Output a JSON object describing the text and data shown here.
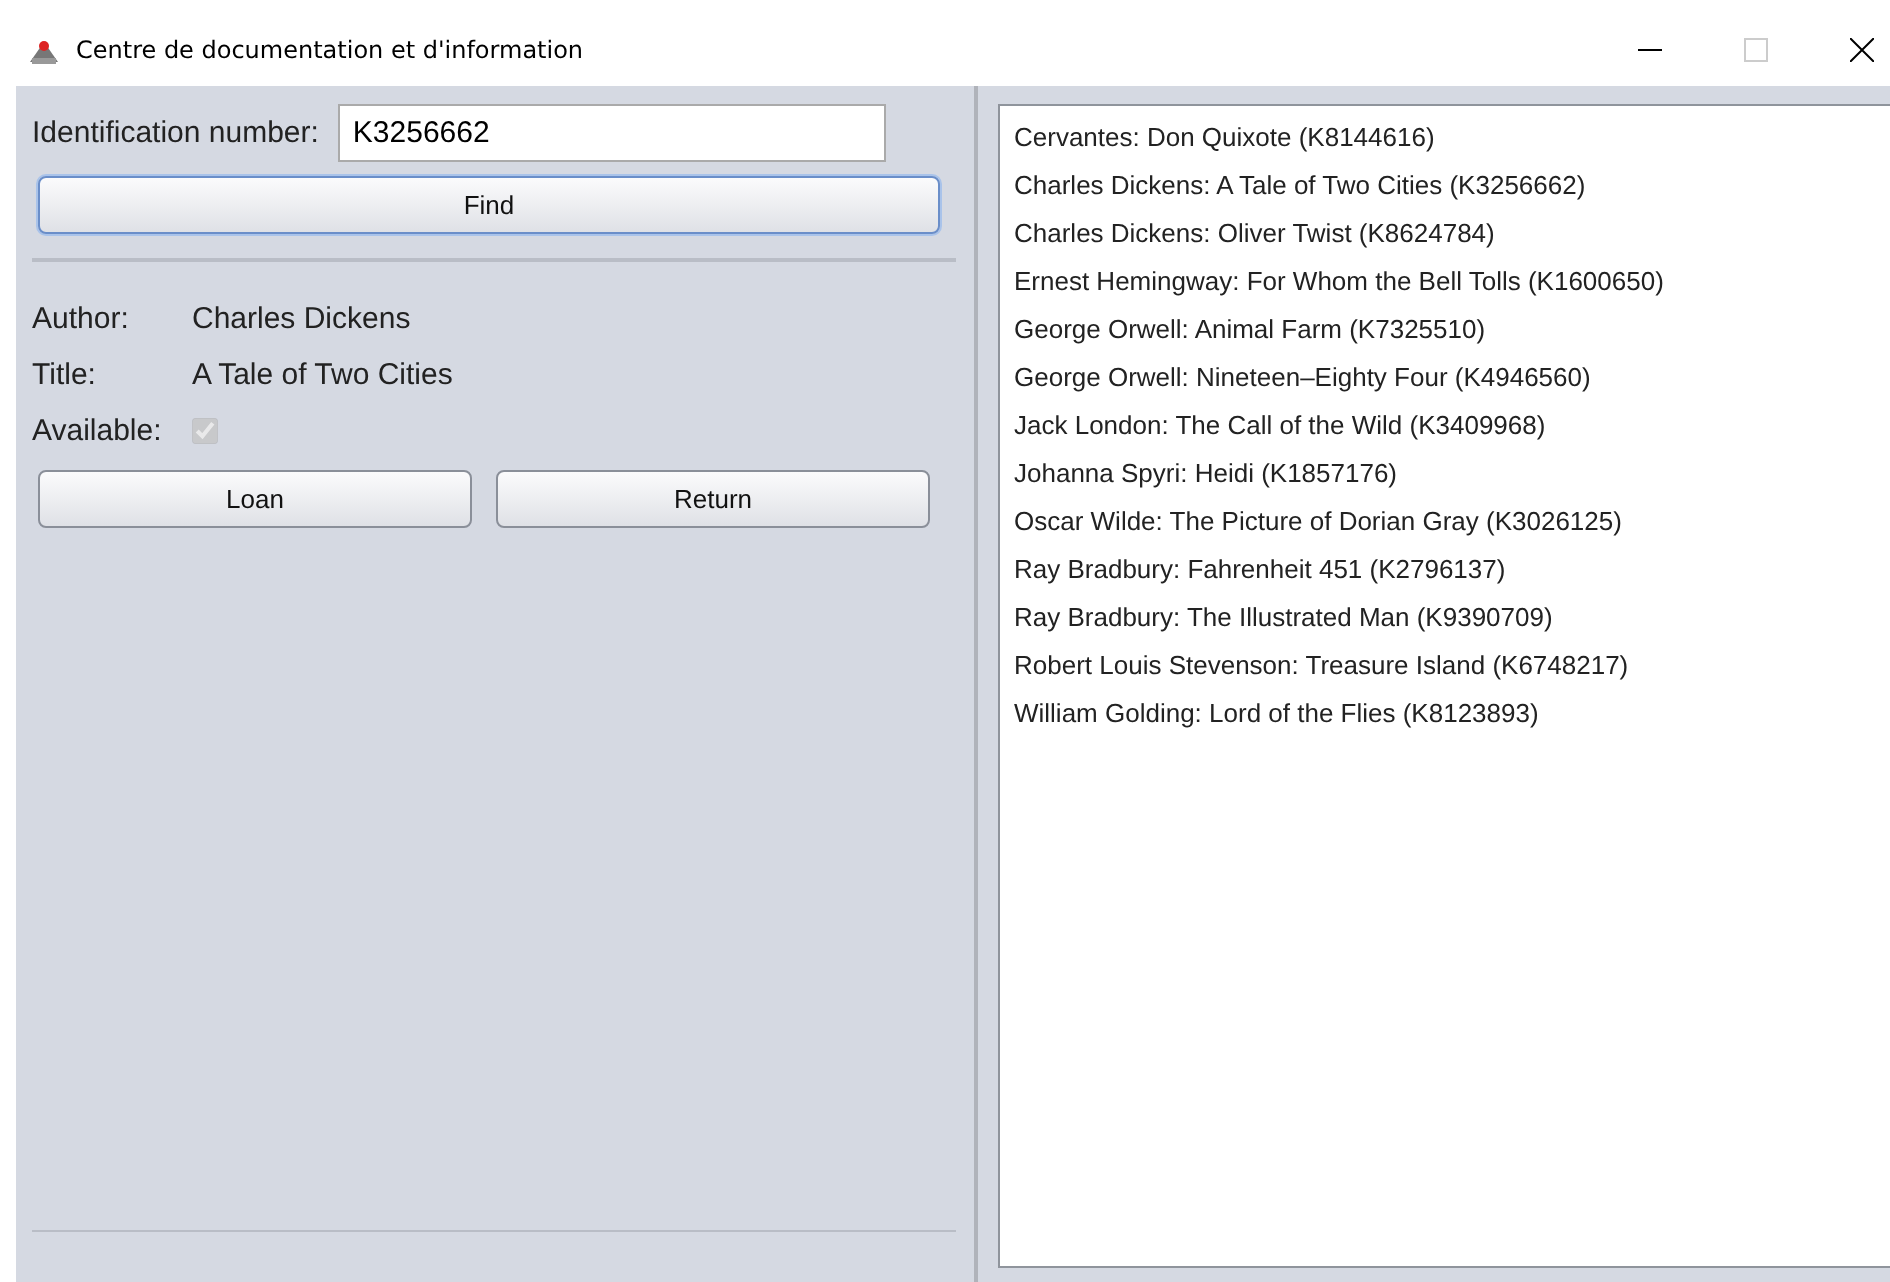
{
  "window": {
    "title": "Centre de documentation et d'information"
  },
  "search": {
    "label": "Identification number:",
    "value": "K3256662",
    "button": "Find"
  },
  "details": [
    {
      "kind": "text",
      "label": "Author:",
      "value": "Charles Dickens"
    },
    {
      "kind": "text",
      "label": "Title:",
      "value": "A Tale of Two Cities"
    },
    {
      "kind": "checkbox",
      "label": "Available:",
      "checked": true,
      "disabled": true
    }
  ],
  "buttons": [
    "Loan",
    "Return"
  ],
  "books": [
    "Cervantes: Don Quixote (K8144616)",
    "Charles Dickens: A Tale of Two Cities (K3256662)",
    "Charles Dickens: Oliver Twist (K8624784)",
    "Ernest Hemingway: For Whom the Bell Tolls (K1600650)",
    "George Orwell: Animal Farm (K7325510)",
    "George Orwell: Nineteen–Eighty Four (K4946560)",
    "Jack London: The Call of the Wild (K3409968)",
    "Johanna Spyri: Heidi (K1857176)",
    "Oscar Wilde: The Picture of Dorian Gray (K3026125)",
    "Ray Bradbury: Fahrenheit 451 (K2796137)",
    "Ray Bradbury: The Illustrated Man (K9390709)",
    "Robert Louis Stevenson: Treasure Island (K6748217)",
    "William Golding: Lord of the Flies (K8123893)"
  ]
}
